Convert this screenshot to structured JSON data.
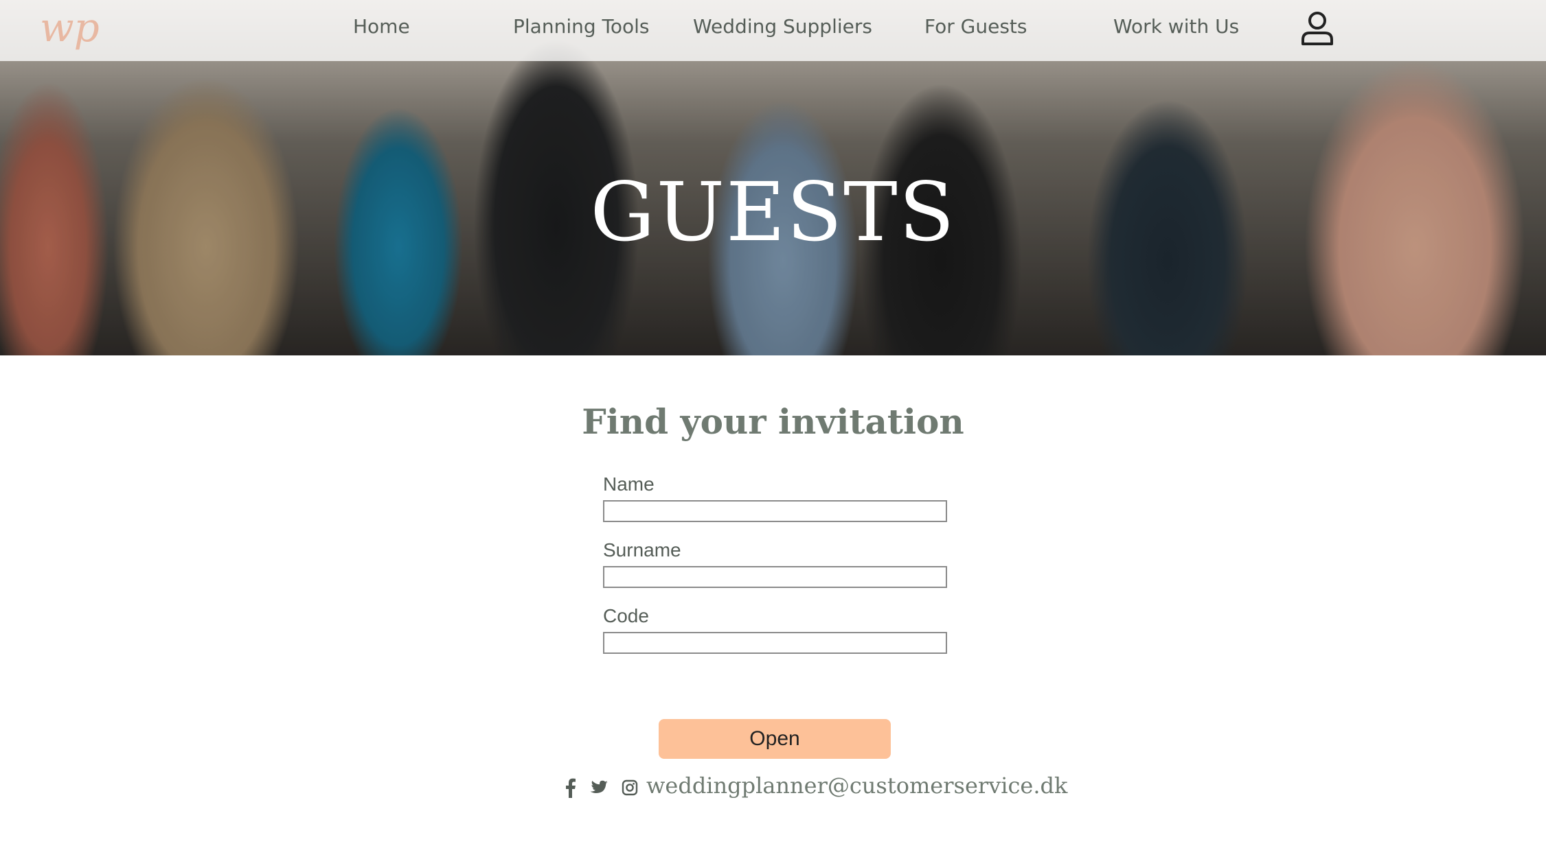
{
  "brand": {
    "logo_text": "wp",
    "logo_color": "#e8b8a2"
  },
  "nav": {
    "items": [
      "Home",
      "Planning Tools",
      "Wedding Suppliers",
      "For Guests",
      "Work with Us"
    ],
    "user_icon": "user-icon"
  },
  "hero": {
    "title": "GUESTS"
  },
  "form": {
    "title": "Find your invitation",
    "fields": [
      {
        "label": "Name",
        "value": ""
      },
      {
        "label": "Surname",
        "value": ""
      },
      {
        "label": "Code",
        "value": ""
      }
    ],
    "submit_label": "Open",
    "submit_color": "#fdc198"
  },
  "footer": {
    "icons": [
      "facebook-icon",
      "twitter-icon",
      "instagram-icon"
    ],
    "email": "weddingplanner@customerservice.dk"
  }
}
